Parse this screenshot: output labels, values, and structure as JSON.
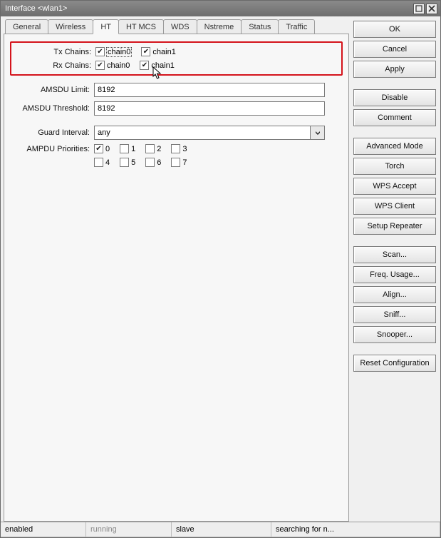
{
  "window": {
    "title": "Interface <wlan1>"
  },
  "tabs": [
    "General",
    "Wireless",
    "HT",
    "HT MCS",
    "WDS",
    "Nstreme",
    "Status",
    "Traffic"
  ],
  "active_tab": 2,
  "chains": {
    "tx_label": "Tx Chains:",
    "rx_label": "Rx Chains:",
    "opts": [
      "chain0",
      "chain1"
    ],
    "tx": [
      true,
      true
    ],
    "rx": [
      true,
      true
    ]
  },
  "fields": {
    "amsdu_limit": {
      "label": "AMSDU Limit:",
      "value": "8192"
    },
    "amsdu_threshold": {
      "label": "AMSDU Threshold:",
      "value": "8192"
    },
    "guard_interval": {
      "label": "Guard Interval:",
      "value": "any"
    },
    "ampdu_priorities": {
      "label": "AMPDU Priorities:",
      "options": [
        "0",
        "1",
        "2",
        "3",
        "4",
        "5",
        "6",
        "7"
      ],
      "checked": [
        true,
        false,
        false,
        false,
        false,
        false,
        false,
        false
      ]
    }
  },
  "buttons": {
    "ok": "OK",
    "cancel": "Cancel",
    "apply": "Apply",
    "disable": "Disable",
    "comment": "Comment",
    "advanced_mode": "Advanced Mode",
    "torch": "Torch",
    "wps_accept": "WPS Accept",
    "wps_client": "WPS Client",
    "setup_repeater": "Setup Repeater",
    "scan": "Scan...",
    "freq_usage": "Freq. Usage...",
    "align": "Align...",
    "sniff": "Sniff...",
    "snooper": "Snooper...",
    "reset_config": "Reset Configuration"
  },
  "status": {
    "c1": "enabled",
    "c2": "running",
    "c3": "slave",
    "c4": "searching for n..."
  }
}
